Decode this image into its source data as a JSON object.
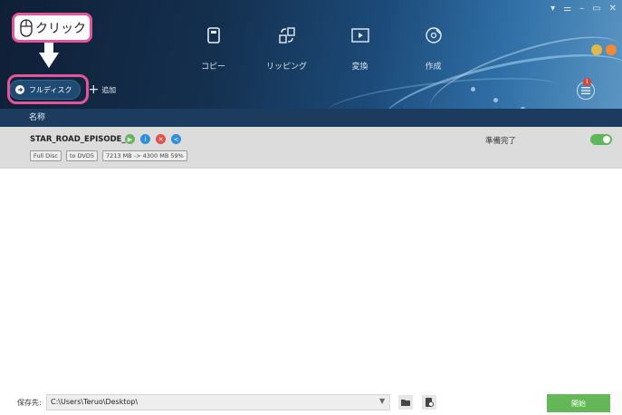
{
  "window": {
    "controls": [
      "▾",
      "⚌",
      "–",
      "▭",
      "✕"
    ]
  },
  "nav": [
    {
      "label": "コピー",
      "icon": "copy-icon"
    },
    {
      "label": "リッピング",
      "icon": "ripping-icon"
    },
    {
      "label": "変換",
      "icon": "convert-icon"
    },
    {
      "label": "作成",
      "icon": "create-icon"
    }
  ],
  "toolbar": {
    "full_disc_label": "フルディスク",
    "add_label": "追加"
  },
  "menu": {
    "badge_count": "1"
  },
  "list": {
    "column_header": "名称"
  },
  "annotation": {
    "callout_text": "クリック"
  },
  "task": {
    "name": "STAR_ROAD_EPISODE_III",
    "tags": [
      "Full Disc",
      "to DVD5",
      "7213 MB -> 4300 MB 59%"
    ],
    "status": "準備完了",
    "enabled": true
  },
  "footer": {
    "save_label": "保存先:",
    "save_path": "C:\\Users\\Teruo\\Desktop\\",
    "start_label": "開始"
  },
  "colors": {
    "accent_green": "#63b756",
    "callout_pink": "#e6559a",
    "header_dark": "#14304f"
  }
}
